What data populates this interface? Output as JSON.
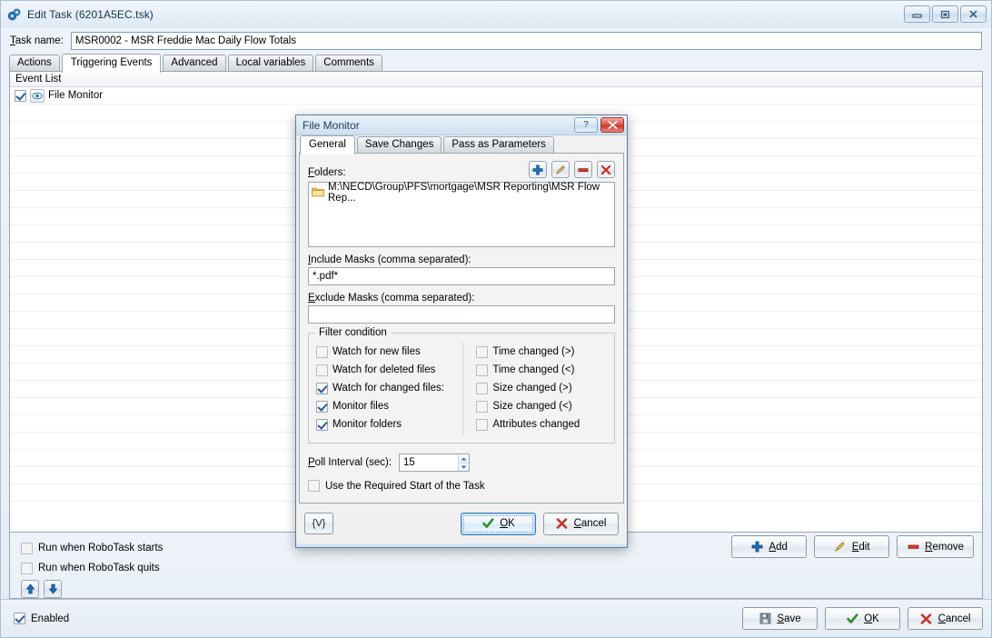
{
  "window": {
    "title": "Edit Task (6201A5EC.tsk)",
    "icon": "gears-icon",
    "controls": {
      "minimize": "minimize-icon",
      "restore": "restore-icon",
      "close": "close-icon"
    }
  },
  "task_name": {
    "label": "Task name:",
    "label_accel": "T",
    "value": "MSR0002 - MSR Freddie Mac Daily Flow Totals"
  },
  "tabs": [
    {
      "label": "Actions",
      "active": false
    },
    {
      "label": "Triggering Events",
      "active": true
    },
    {
      "label": "Advanced",
      "active": false
    },
    {
      "label": "Local variables",
      "active": false
    },
    {
      "label": "Comments",
      "active": false
    }
  ],
  "event_list": {
    "header": "Event List",
    "rows": [
      {
        "checked": true,
        "icon": "eye-icon",
        "label": "File Monitor"
      }
    ]
  },
  "run_options": [
    {
      "label": "Run when RoboTask starts",
      "checked": false
    },
    {
      "label": "Run when RoboTask quits",
      "checked": false
    }
  ],
  "move_buttons": [
    {
      "name": "move-up-button",
      "icon": "arrow-up-icon"
    },
    {
      "name": "move-down-button",
      "icon": "arrow-down-icon"
    }
  ],
  "list_actions": [
    {
      "label": "Add",
      "accel": "A",
      "icon": "plus-icon"
    },
    {
      "label": "Edit",
      "accel": "E",
      "icon": "pencil-icon"
    },
    {
      "label": "Remove",
      "accel": "R",
      "icon": "minus-icon"
    }
  ],
  "bottom": {
    "enabled": {
      "label": "Enabled",
      "checked": true
    },
    "buttons": [
      {
        "label": "Save",
        "accel": "S",
        "icon": "floppy-icon"
      },
      {
        "label": "OK",
        "accel": "O",
        "icon": "check-icon"
      },
      {
        "label": "Cancel",
        "accel": "C",
        "icon": "cross-icon"
      }
    ]
  },
  "dialog": {
    "title": "File Monitor",
    "help_glyph": "?",
    "close_glyph": "✖",
    "tabs": [
      {
        "label": "General",
        "active": true
      },
      {
        "label": "Save Changes",
        "active": false
      },
      {
        "label": "Pass as Parameters",
        "active": false
      }
    ],
    "folders": {
      "label": "Folders:",
      "label_accel": "F",
      "toolbar": [
        {
          "name": "add-folder-button",
          "icon": "plus-icon"
        },
        {
          "name": "edit-folder-button",
          "icon": "pencil-icon"
        },
        {
          "name": "remove-folder-button",
          "icon": "minus-icon"
        },
        {
          "name": "clear-folders-button",
          "icon": "cross-icon"
        }
      ],
      "items": [
        {
          "icon": "folder-icon",
          "path": "M:\\NECD\\Group\\PFS\\mortgage\\MSR Reporting\\MSR Flow Rep..."
        }
      ]
    },
    "include_masks": {
      "label": "Include Masks (comma separated):",
      "label_accel": "I",
      "value": "*.pdf*"
    },
    "exclude_masks": {
      "label": "Exclude Masks (comma separated):",
      "label_accel": "E",
      "value": ""
    },
    "filter_condition": {
      "legend": "Filter condition",
      "left": [
        {
          "label": "Watch for new files",
          "checked": false
        },
        {
          "label": "Watch for deleted files",
          "checked": false
        },
        {
          "label": "Watch for changed files:",
          "checked": true
        },
        {
          "label": "Monitor files",
          "checked": true
        },
        {
          "label": "Monitor folders",
          "checked": true
        }
      ],
      "right": [
        {
          "label": "Time changed (>)",
          "checked": false
        },
        {
          "label": "Time changed (<)",
          "checked": false
        },
        {
          "label": "Size changed (>)",
          "checked": false
        },
        {
          "label": "Size changed (<)",
          "checked": false
        },
        {
          "label": "Attributes changed",
          "checked": false
        }
      ]
    },
    "poll_interval": {
      "label": "Poll Interval (sec):",
      "label_accel": "P",
      "value": "15"
    },
    "required_start": {
      "label": "Use the Required Start of the Task",
      "checked": false
    },
    "footer": {
      "variable_button": "{V}",
      "ok": {
        "label": "OK",
        "accel": "O",
        "icon": "check-icon",
        "focused": true
      },
      "cancel": {
        "label": "Cancel",
        "accel": "C",
        "icon": "cross-icon",
        "focused": false
      }
    }
  },
  "colors": {
    "accent_blue": "#2c5c9c",
    "window_chrome": "#dfe9f4",
    "dialog_bg": "#f3f3f3",
    "close_red": "#c9392e",
    "folder_yellow": "#f5c463",
    "check_green": "#2f8f2f",
    "cross_red": "#c0392b"
  }
}
